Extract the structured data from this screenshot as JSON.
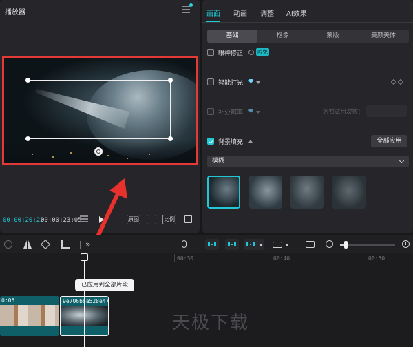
{
  "player": {
    "title": "播放器",
    "time_current": "00:00:20:22",
    "time_total": "00:00:23:05",
    "original_label": "原图",
    "ratio_label": "比例"
  },
  "properties": {
    "main_tabs": [
      "画面",
      "动画",
      "调整",
      "AI效果"
    ],
    "sub_tabs": [
      "基础",
      "抠像",
      "蒙版",
      "美颜美体"
    ],
    "options": {
      "eye_correction": {
        "label": "眼神修正",
        "badge": "限免"
      },
      "smart_light": {
        "label": "智能打光"
      },
      "frame_interp": {
        "label": "补分辨率",
        "trial": "您暂试用次数："
      },
      "background_fill": {
        "label": "背景填充",
        "apply_all": "全部应用",
        "mode": "模糊"
      }
    }
  },
  "timeline": {
    "ticks": [
      "00:30",
      "00:40",
      "00:50"
    ],
    "tooltip": "已应用到全部片段",
    "clip_1_label": "0:05",
    "clip_2_label": "9e706b6a528e47",
    "zoom_level": 0.1
  },
  "watermark": "天极下载",
  "colors": {
    "accent": "#21c7d2",
    "highlight_border": "#e43a37",
    "arrow": "#e8312d"
  }
}
